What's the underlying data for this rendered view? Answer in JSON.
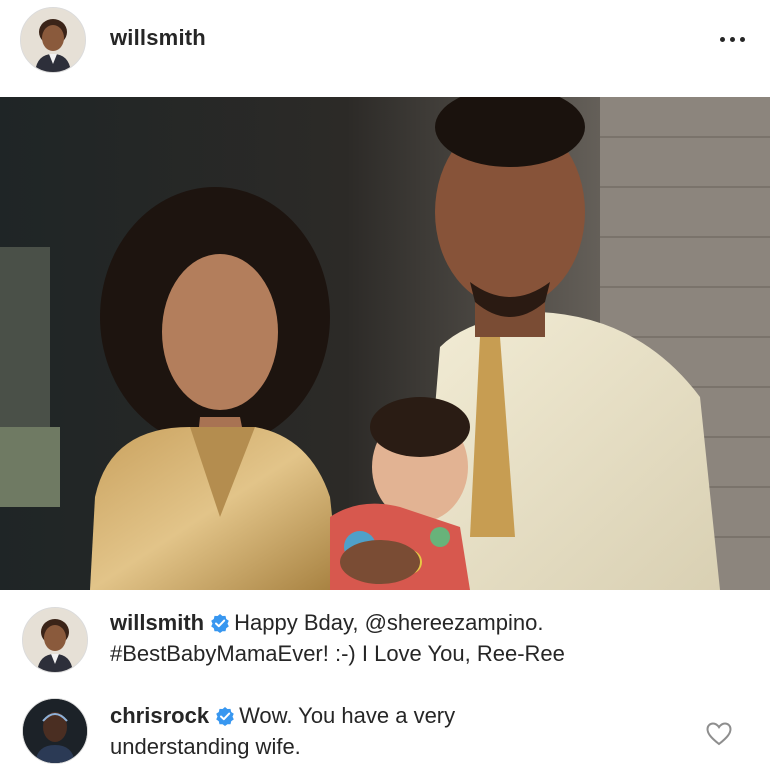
{
  "post": {
    "username": "willsmith",
    "more_icon": "more-horizontal-icon"
  },
  "photo": {
    "subject": "family-portrait-photo"
  },
  "comments": [
    {
      "author": "willsmith",
      "verified": true,
      "line1": "Happy Bday, @shereezampino.",
      "line2": "#BestBabyMamaEver! :-) I Love You, Ree-Ree"
    },
    {
      "author": "chrisrock",
      "verified": true,
      "line1": "Wow. You have a very",
      "line2": "understanding wife."
    }
  ],
  "colors": {
    "text": "#262626",
    "verified_blue": "#3897f0",
    "border": "#dbdbdb"
  }
}
